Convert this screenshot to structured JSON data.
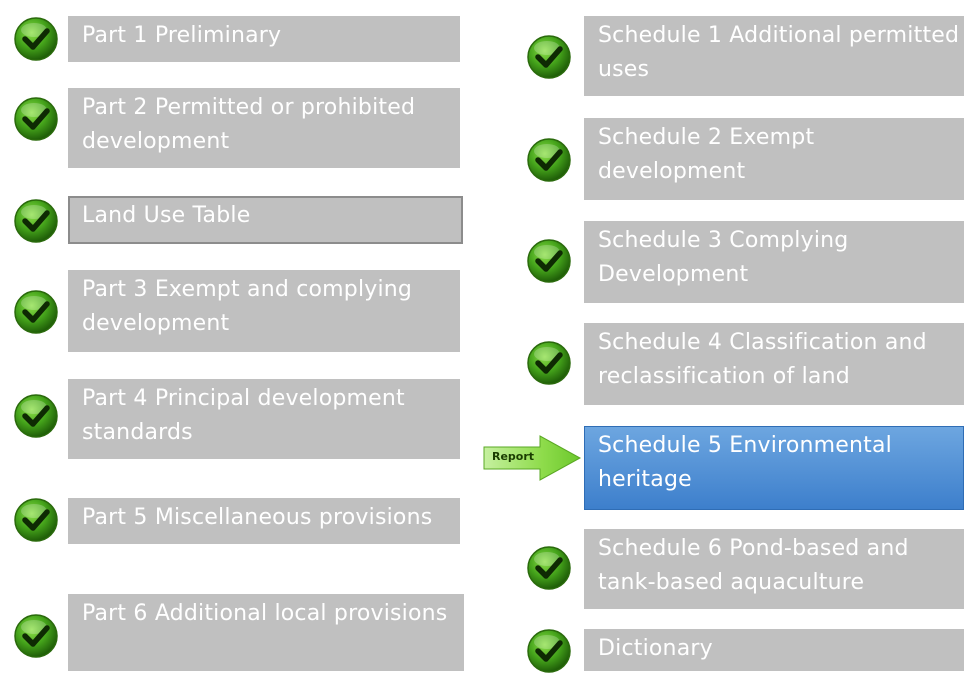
{
  "colors": {
    "box_gray": "#c0c0c0",
    "box_active": "#4a8ad4",
    "check_green": "#3b8f15",
    "arrow_green": "#7dd23c",
    "text": "#ffffff"
  },
  "left_items": [
    {
      "label": "Part 1 Preliminary",
      "icon": "checkmark-icon"
    },
    {
      "label": "Part 2 Permitted or prohibited development",
      "icon": "checkmark-icon"
    },
    {
      "label": "Land Use Table",
      "icon": "checkmark-icon"
    },
    {
      "label": "Part 3 Exempt and complying development",
      "icon": "checkmark-icon"
    },
    {
      "label": "Part 4 Principal development standards",
      "icon": "checkmark-icon"
    },
    {
      "label": "Part 5 Miscellaneous provisions",
      "icon": "checkmark-icon"
    },
    {
      "label": "Part 6 Additional local provisions",
      "icon": "checkmark-icon"
    }
  ],
  "right_items": [
    {
      "label": "Schedule 1 Additional permitted uses",
      "icon": "checkmark-icon"
    },
    {
      "label": "Schedule 2 Exempt development",
      "icon": "checkmark-icon"
    },
    {
      "label": "Schedule 3 Complying Development",
      "icon": "checkmark-icon"
    },
    {
      "label": "Schedule 4 Classification and reclassification of land",
      "icon": "checkmark-icon"
    },
    {
      "label": "Schedule 5 Environmental heritage",
      "state": "current"
    },
    {
      "label": "Schedule 6 Pond-based and tank-based aquaculture",
      "icon": "checkmark-icon"
    },
    {
      "label": "Dictionary",
      "icon": "checkmark-icon"
    }
  ],
  "current_marker": {
    "label": "Report",
    "icon": "right-arrow-icon"
  }
}
